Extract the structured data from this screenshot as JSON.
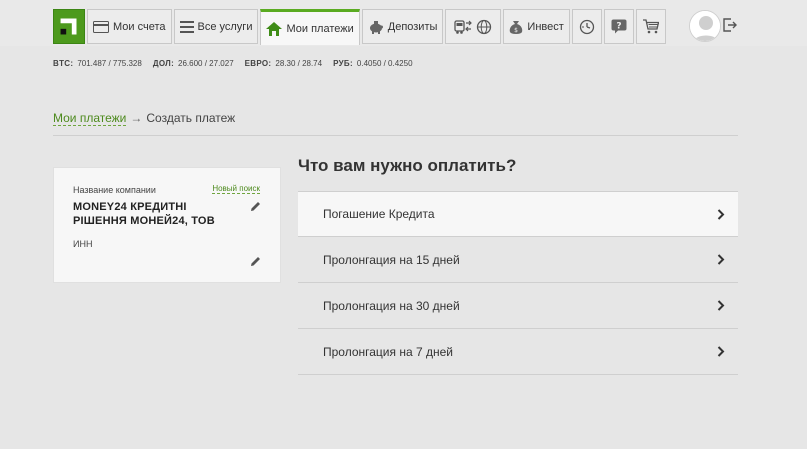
{
  "nav": {
    "accounts_label": "Мои счета",
    "services_label": "Все услуги",
    "payments_label": "Мои платежи",
    "deposits_label": "Депозиты",
    "invest_label": "Инвест"
  },
  "rates": [
    {
      "key": "BTC:",
      "value": "701.487 / 775.328"
    },
    {
      "key": "ДОЛ:",
      "value": "26.600 / 27.027"
    },
    {
      "key": "ЕВРО:",
      "value": "28.30 / 28.74"
    },
    {
      "key": "РУБ:",
      "value": "0.4050 / 0.4250"
    }
  ],
  "breadcrumb": {
    "link": "Мои платежи",
    "arrow": "→",
    "current": "Создать платеж"
  },
  "card": {
    "company_label": "Название компании",
    "new_search": "Новый поиск",
    "company_name": "MONEY24 КРЕДИТНІ РІШЕННЯ МОНЕЙ24, ТОВ",
    "inn_label": "ИНН"
  },
  "main": {
    "question": "Что вам нужно оплатить?",
    "items": [
      {
        "label": "Погашение Кредита"
      },
      {
        "label": "Пролонгация на 15 дней"
      },
      {
        "label": "Пролонгация на 30 дней"
      },
      {
        "label": "Пролонгация на 7 дней"
      }
    ]
  },
  "colors": {
    "brand_green": "#4d9a1d",
    "link_green": "#4d8a1d",
    "background": "#e6e6e6"
  }
}
